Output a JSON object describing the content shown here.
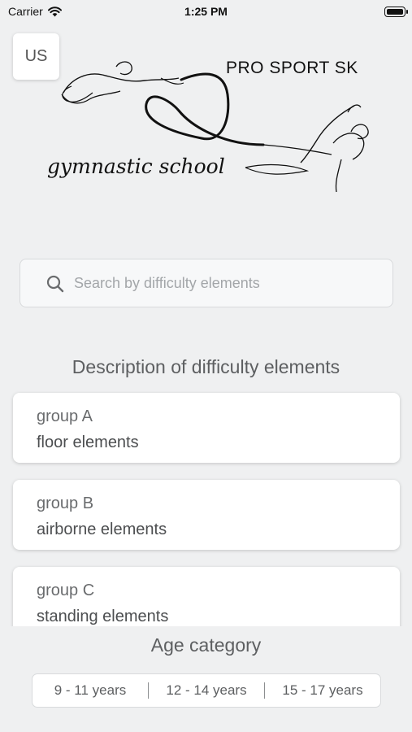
{
  "status_bar": {
    "carrier": "Carrier",
    "time": "1:25 PM"
  },
  "language_button": {
    "label": "US"
  },
  "logo": {
    "brand": "PRO SPORT SK",
    "script": "gymnastic school"
  },
  "search": {
    "placeholder": "Search by difficulty elements",
    "value": ""
  },
  "description_section": {
    "title": "Description of difficulty elements",
    "groups": [
      {
        "group": "group A",
        "name": "floor elements"
      },
      {
        "group": "group B",
        "name": "airborne elements"
      },
      {
        "group": "group C",
        "name": "standing elements"
      }
    ]
  },
  "age_section": {
    "title": "Age category",
    "options": [
      "9 - 11 years",
      "12 - 14 years",
      "15 - 17 years"
    ]
  },
  "colors": {
    "background": "#eff0f1",
    "card": "#ffffff",
    "text": "#5d5f61"
  }
}
